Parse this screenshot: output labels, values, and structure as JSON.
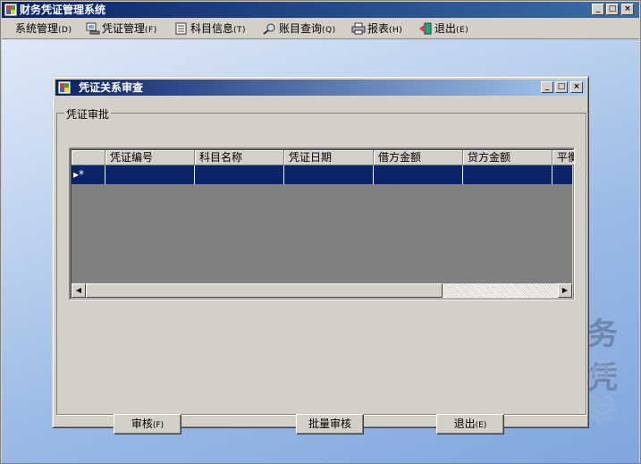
{
  "window": {
    "title": "财务凭证管理系统",
    "controls": [
      "_",
      "□",
      "×"
    ]
  },
  "menu": [
    {
      "label": "系统管理",
      "accel": "(D)",
      "icon": ""
    },
    {
      "label": "凭证管理",
      "accel": "(F)",
      "icon": "voucher-icon"
    },
    {
      "label": "科目信息",
      "accel": "(T)",
      "icon": "ledger-icon"
    },
    {
      "label": "账目查询",
      "accel": "(Q)",
      "icon": "search-icon"
    },
    {
      "label": "报表",
      "accel": "(H)",
      "icon": "printer-icon"
    },
    {
      "label": "退出",
      "accel": "(E)",
      "icon": "exit-door-icon"
    }
  ],
  "background_watermark": "务凭",
  "dialog": {
    "title": "凭证关系审查",
    "group_label": "凭证审批",
    "grid": {
      "columns": [
        "凭证编号",
        "科目名称",
        "凭证日期",
        "借方金额",
        "贷方金额",
        "平衡"
      ],
      "new_row_marker": "▸*",
      "rows": []
    },
    "buttons": [
      {
        "label": "审核",
        "accel": "(F)"
      },
      {
        "label": "批量审核",
        "accel": ""
      },
      {
        "label": "退出",
        "accel": "(E)"
      }
    ]
  },
  "colors": {
    "titlebar": "#0a246a",
    "selection": "#0a246a",
    "face": "#d4d0c8",
    "grid_background": "#808080"
  }
}
